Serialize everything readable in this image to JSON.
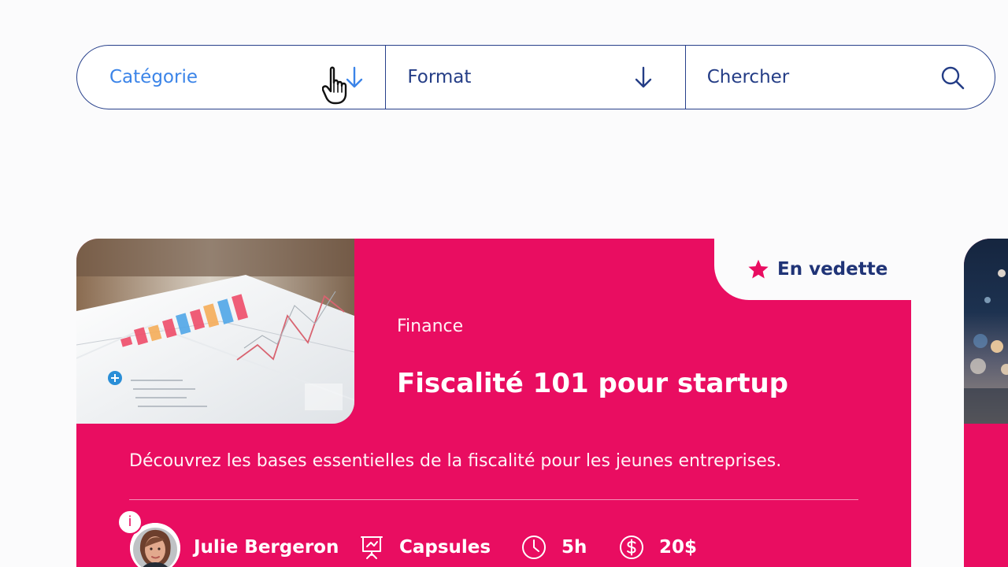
{
  "filters": {
    "category": {
      "label": "Catégorie",
      "icon": "arrow-down-icon"
    },
    "format": {
      "label": "Format",
      "icon": "arrow-down-icon"
    },
    "search": {
      "placeholder": "Chercher",
      "icon": "search-icon"
    }
  },
  "featured_card": {
    "badge": {
      "label": "En vedette",
      "icon": "star-icon"
    },
    "category": "Finance",
    "title": "Fiscalité 101 pour startup",
    "description": "Découvrez les bases essentielles de la fiscalité pour les jeunes entreprises.",
    "author": {
      "name": "Julie Bergeron",
      "badge": "i"
    },
    "format": "Capsules",
    "duration": "5h",
    "price": "20$",
    "colors": {
      "card": "#e90d61",
      "navy": "#203477",
      "accent_blue": "#3b84e8"
    }
  },
  "cursor": {
    "icon": "hand-cursor-icon"
  }
}
